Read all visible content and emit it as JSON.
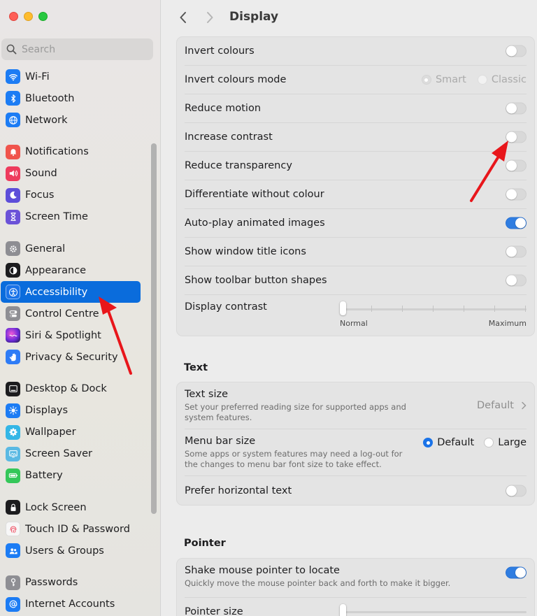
{
  "window": {
    "controls": [
      "close",
      "minimize",
      "zoom"
    ]
  },
  "search": {
    "placeholder": "Search"
  },
  "sidebar": {
    "items": [
      {
        "label": "Wi-Fi",
        "icon": "wifi-icon",
        "color": "#1c7cf4"
      },
      {
        "label": "Bluetooth",
        "icon": "bluetooth-icon",
        "color": "#1c7cf4"
      },
      {
        "label": "Network",
        "icon": "globe-icon",
        "color": "#1c7cf4"
      },
      {
        "label": "Notifications",
        "icon": "bell-icon",
        "color": "#f0544c"
      },
      {
        "label": "Sound",
        "icon": "speaker-icon",
        "color": "#ee3b5d"
      },
      {
        "label": "Focus",
        "icon": "moon-icon",
        "color": "#5d4ed9"
      },
      {
        "label": "Screen Time",
        "icon": "hourglass-icon",
        "color": "#6b52d8"
      },
      {
        "label": "General",
        "icon": "gear-icon",
        "color": "#8e8e93"
      },
      {
        "label": "Appearance",
        "icon": "appearance-icon",
        "color": "#1c1c1e"
      },
      {
        "label": "Accessibility",
        "icon": "accessibility-icon",
        "color": "#1a73e8"
      },
      {
        "label": "Control Centre",
        "icon": "toggles-icon",
        "color": "#8e8e93"
      },
      {
        "label": "Siri & Spotlight",
        "icon": "siri-icon",
        "color": "#c2329b"
      },
      {
        "label": "Privacy & Security",
        "icon": "hand-icon",
        "color": "#2e7cf6"
      },
      {
        "label": "Desktop & Dock",
        "icon": "dock-icon",
        "color": "#1c1c1e"
      },
      {
        "label": "Displays",
        "icon": "sun-icon",
        "color": "#1c7cf4"
      },
      {
        "label": "Wallpaper",
        "icon": "flower-icon",
        "color": "#33b6e6"
      },
      {
        "label": "Screen Saver",
        "icon": "screensaver-icon",
        "color": "#5ab9e3"
      },
      {
        "label": "Battery",
        "icon": "battery-icon",
        "color": "#34c759"
      },
      {
        "label": "Lock Screen",
        "icon": "lock-icon",
        "color": "#1c1c1e"
      },
      {
        "label": "Touch ID & Password",
        "icon": "fingerprint-icon",
        "color": "#f2f2f2"
      },
      {
        "label": "Users & Groups",
        "icon": "users-icon",
        "color": "#1c7cf4"
      },
      {
        "label": "Passwords",
        "icon": "key-icon",
        "color": "#8e8e93"
      },
      {
        "label": "Internet Accounts",
        "icon": "at-icon",
        "color": "#1c7cf4"
      }
    ],
    "active": "Accessibility"
  },
  "header": {
    "title": "Display"
  },
  "display": {
    "invert_colours": "Invert colours",
    "invert_mode": "Invert colours mode",
    "invert_mode_smart": "Smart",
    "invert_mode_classic": "Classic",
    "reduce_motion": "Reduce motion",
    "increase_contrast": "Increase contrast",
    "reduce_transparency": "Reduce transparency",
    "differentiate": "Differentiate without colour",
    "autoplay": "Auto-play animated images",
    "window_title_icons": "Show window title icons",
    "toolbar_shapes": "Show toolbar button shapes",
    "display_contrast": "Display contrast",
    "contrast_min": "Normal",
    "contrast_max": "Maximum",
    "contrast_value": 0
  },
  "toggles": {
    "invert_colours": false,
    "reduce_motion": false,
    "increase_contrast": false,
    "reduce_transparency": false,
    "differentiate": false,
    "autoplay": true,
    "window_title_icons": false,
    "toolbar_shapes": false,
    "prefer_horizontal": false,
    "shake_pointer": true
  },
  "text_section": {
    "title": "Text",
    "text_size": "Text size",
    "text_size_sub": "Set your preferred reading size for supported apps and system features.",
    "text_size_value": "Default",
    "menu_bar_size": "Menu bar size",
    "menu_bar_sub": "Some apps or system features may need a log-out for the changes to menu bar font size to take effect.",
    "menu_default": "Default",
    "menu_large": "Large",
    "prefer_horizontal": "Prefer horizontal text"
  },
  "pointer_section": {
    "title": "Pointer",
    "shake": "Shake mouse pointer to locate",
    "shake_sub": "Quickly move the mouse pointer back and forth to make it bigger.",
    "pointer_size": "Pointer size"
  },
  "colors": {
    "accent": "#0a6cdc",
    "annotation_arrow": "#e8161b"
  }
}
